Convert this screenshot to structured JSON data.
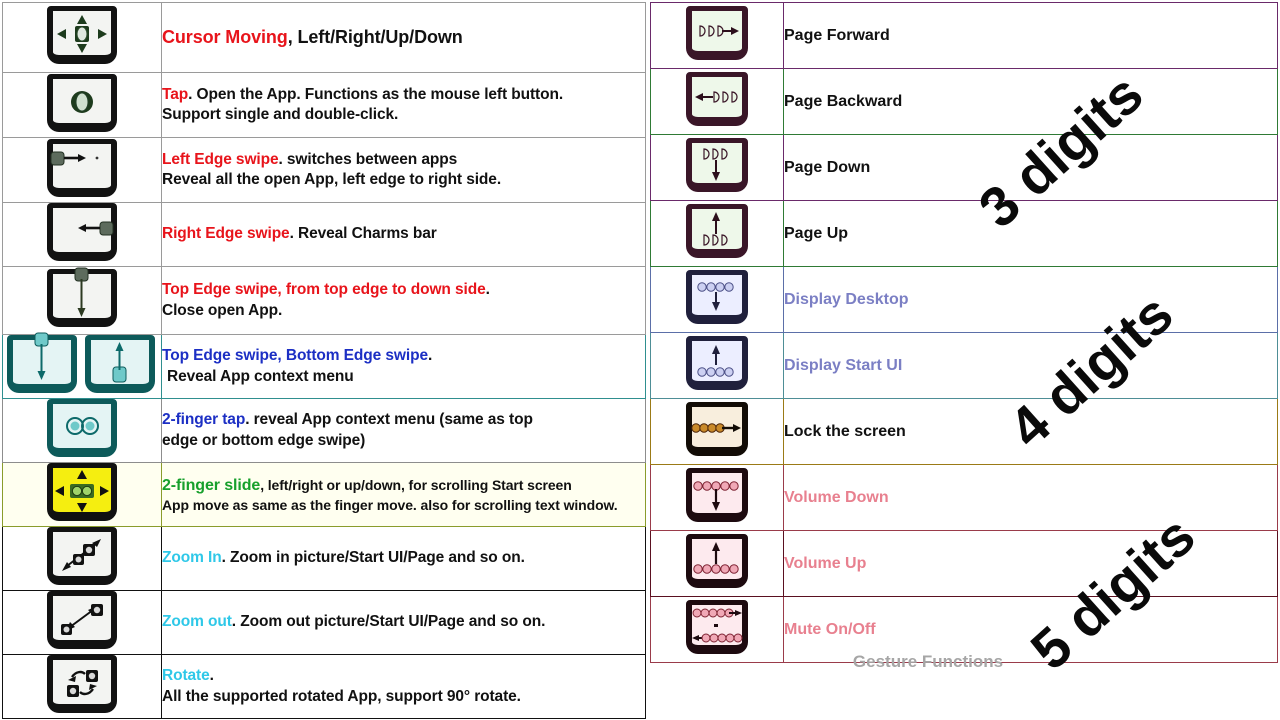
{
  "caption": "Gesture Functions",
  "watermarks": [
    {
      "label": "3 digits"
    },
    {
      "label": "4 digits"
    },
    {
      "label": "5 digits"
    }
  ],
  "left_table": {
    "rows": [
      {
        "icon": "cursor-moving-icon",
        "lines": [
          {
            "parts": [
              {
                "text": "Cursor Moving",
                "color": "red"
              },
              {
                "text": ", Left/Right/Up/Down",
                "color": "black"
              }
            ]
          }
        ]
      },
      {
        "icon": "tap-icon",
        "lines": [
          {
            "parts": [
              {
                "text": "Tap",
                "color": "red"
              },
              {
                "text": ". Open the App. Functions as the mouse left button.",
                "color": "black"
              }
            ]
          },
          {
            "parts": [
              {
                "text": "Support single and double-click.",
                "color": "black"
              }
            ]
          }
        ]
      },
      {
        "icon": "left-edge-swipe-icon",
        "lines": [
          {
            "parts": [
              {
                "text": "Left Edge swipe",
                "color": "red"
              },
              {
                "text": ".  switches between apps",
                "color": "black"
              }
            ]
          },
          {
            "parts": [
              {
                "text": "Reveal all the open App, left edge to right side.",
                "color": "black"
              }
            ]
          }
        ]
      },
      {
        "icon": "right-edge-swipe-icon",
        "lines": [
          {
            "parts": [
              {
                "text": "Right Edge swipe",
                "color": "red"
              },
              {
                "text": ". Reveal Charms bar",
                "color": "black"
              }
            ]
          }
        ]
      },
      {
        "icon": "top-edge-swipe-icon",
        "lines": [
          {
            "parts": [
              {
                "text": "Top Edge swipe, from top edge to down side",
                "color": "red"
              },
              {
                "text": ".",
                "color": "black"
              }
            ]
          },
          {
            "parts": [
              {
                "text": "Close open App.",
                "color": "black"
              }
            ]
          }
        ]
      },
      {
        "icon": "top-and-bottom-edge-swipe-icon",
        "lines": [
          {
            "parts": [
              {
                "text": "Top Edge swipe, Bottom Edge swipe",
                "color": "blue"
              },
              {
                "text": ".",
                "color": "black"
              }
            ]
          },
          {
            "parts": [
              {
                "text": "Reveal App context menu",
                "color": "black"
              }
            ]
          }
        ]
      },
      {
        "icon": "two-finger-tap-icon",
        "lines": [
          {
            "parts": [
              {
                "text": "2-finger tap",
                "color": "blue"
              },
              {
                "text": ". reveal App context menu (same as top",
                "color": "black"
              }
            ]
          },
          {
            "parts": [
              {
                "text": "edge or bottom edge swipe)",
                "color": "black"
              }
            ]
          }
        ]
      },
      {
        "icon": "two-finger-slide-icon",
        "lines": [
          {
            "parts": [
              {
                "text": "2-finger slide",
                "color": "green"
              },
              {
                "text": ", left/right or up/down, for scrolling Start screen",
                "color": "black"
              }
            ]
          },
          {
            "parts": [
              {
                "text": "App move as same as the finger move. also for scrolling text window.",
                "color": "black"
              }
            ]
          }
        ]
      },
      {
        "icon": "zoom-in-icon",
        "lines": [
          {
            "parts": [
              {
                "text": "Zoom In",
                "color": "cyan"
              },
              {
                "text": ".  Zoom in picture/Start UI/Page and so on.",
                "color": "black"
              }
            ]
          }
        ]
      },
      {
        "icon": "zoom-out-icon",
        "lines": [
          {
            "parts": [
              {
                "text": "Zoom out",
                "color": "cyan"
              },
              {
                "text": ". Zoom out picture/Start UI/Page and so on.",
                "color": "black"
              }
            ]
          }
        ]
      },
      {
        "icon": "rotate-icon",
        "lines": [
          {
            "parts": [
              {
                "text": "Rotate",
                "color": "cyan"
              },
              {
                "text": ".",
                "color": "black"
              }
            ]
          },
          {
            "parts": [
              {
                "text": "All the supported rotated App, support 90° rotate.",
                "color": "black"
              }
            ]
          }
        ]
      }
    ]
  },
  "right_table": {
    "rows": [
      {
        "icon": "page-forward-icon",
        "label": "Page Forward",
        "color": "black"
      },
      {
        "icon": "page-backward-icon",
        "label": "Page Backward",
        "color": "black"
      },
      {
        "icon": "page-down-icon",
        "label": "Page Down",
        "color": "black"
      },
      {
        "icon": "page-up-icon",
        "label": "Page Up",
        "color": "black"
      },
      {
        "icon": "display-desktop-icon",
        "label": "Display Desktop",
        "color": "violet"
      },
      {
        "icon": "display-start-ui-icon",
        "label": "Display Start UI",
        "color": "violet"
      },
      {
        "icon": "lock-screen-icon",
        "label": "Lock the screen",
        "color": "black"
      },
      {
        "icon": "volume-down-icon",
        "label": "Volume Down",
        "color": "pink"
      },
      {
        "icon": "volume-up-icon",
        "label": "Volume Up",
        "color": "pink"
      },
      {
        "icon": "mute-on-off-icon",
        "label": "Mute On/Off",
        "color": "pink"
      }
    ]
  },
  "colors": {
    "red": "#e8141b",
    "blue": "#1c2fc4",
    "green": "#17a02c",
    "cyan": "#2fc8e8",
    "violet": "#7b7fc4",
    "pink": "#e8808f",
    "caption_gray": "#a6a6a6"
  }
}
